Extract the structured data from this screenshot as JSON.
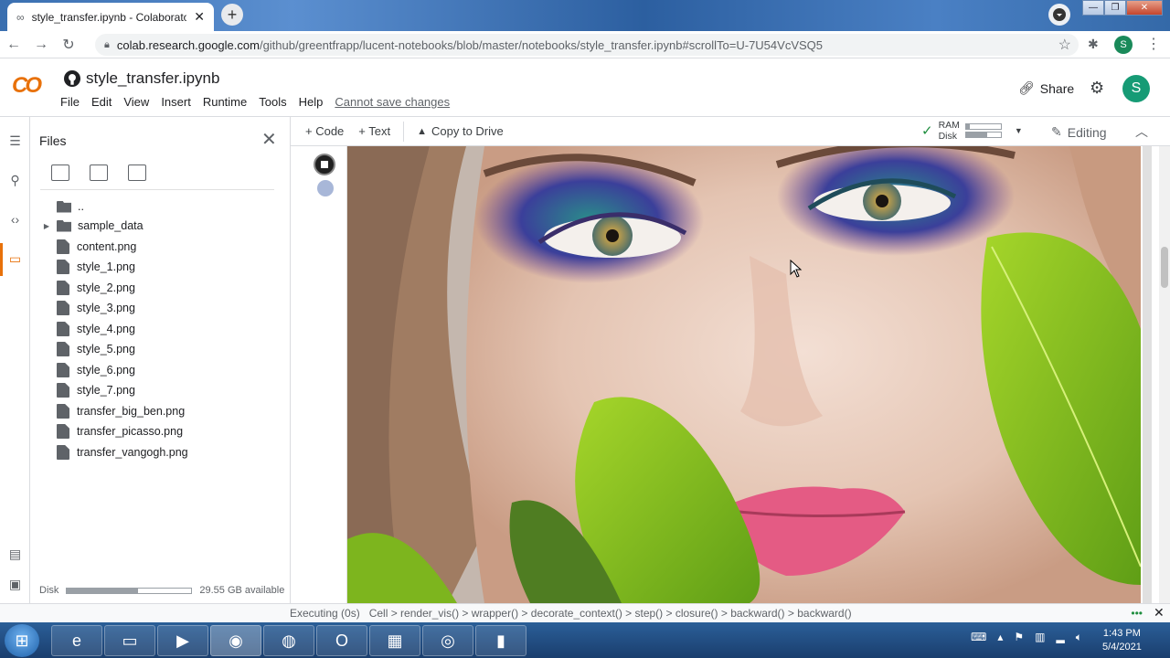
{
  "browser": {
    "tab_title": "style_transfer.ipynb - Colaborator",
    "url_host": "colab.research.google.com",
    "url_path": "/github/greentfrapp/lucent-notebooks/blob/master/notebooks/style_transfer.ipynb#scrollTo=U-7U54VcVSQ5",
    "profile_initial": "S"
  },
  "colab": {
    "logo_a": "C",
    "logo_b": "O",
    "notebook_title": "style_transfer.ipynb",
    "menu": [
      "File",
      "Edit",
      "View",
      "Insert",
      "Runtime",
      "Tools",
      "Help"
    ],
    "save_warning": "Cannot save changes",
    "share_label": "Share",
    "avatar_initial": "S"
  },
  "files_panel": {
    "title": "Files",
    "parent_dir": "..",
    "items": [
      {
        "name": "sample_data",
        "type": "folder"
      },
      {
        "name": "content.png",
        "type": "file"
      },
      {
        "name": "style_1.png",
        "type": "file"
      },
      {
        "name": "style_2.png",
        "type": "file"
      },
      {
        "name": "style_3.png",
        "type": "file"
      },
      {
        "name": "style_4.png",
        "type": "file"
      },
      {
        "name": "style_5.png",
        "type": "file"
      },
      {
        "name": "style_6.png",
        "type": "file"
      },
      {
        "name": "style_7.png",
        "type": "file"
      },
      {
        "name": "transfer_big_ben.png",
        "type": "file"
      },
      {
        "name": "transfer_picasso.png",
        "type": "file"
      },
      {
        "name": "transfer_vangogh.png",
        "type": "file"
      }
    ],
    "disk_label": "Disk",
    "disk_available": "29.55 GB available",
    "disk_used_fraction": 0.57
  },
  "toolbar": {
    "code_label": "+ Code",
    "text_label": "+ Text",
    "copy_label": "Copy to Drive",
    "ram_label": "RAM",
    "disk_label": "Disk",
    "ram_fraction": 0.1,
    "disk_fraction": 0.6,
    "editing_label": "Editing"
  },
  "status": {
    "text": "Executing (0s)   Cell > render_vis() > wrapper() > decorate_context() > step() > closure() > backward() > backward()"
  },
  "taskbar": {
    "time": "1:43 PM",
    "date": "5/4/2021"
  }
}
